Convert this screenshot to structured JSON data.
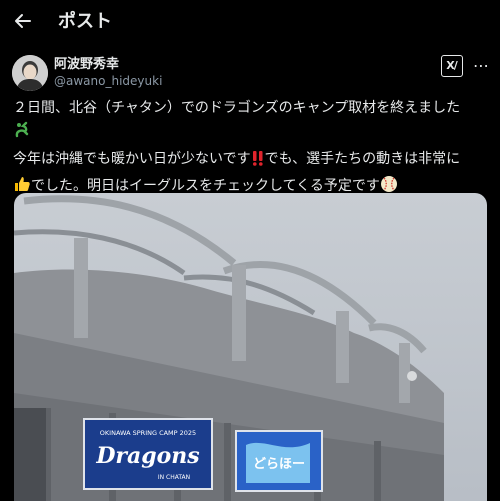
{
  "header": {
    "title": "ポスト",
    "back_icon": "arrow-left-icon"
  },
  "author": {
    "display_name": "阿波野秀幸",
    "handle": "@awano_hideyuki"
  },
  "actions": {
    "grok_icon": "grok-icon",
    "more_icon": "more-icon"
  },
  "tweet": {
    "line1": "２日間、北谷（チャタン）でのドラゴンズのキャンプ取材を終えました",
    "line2a": "今年は沖縄でも暖かい日が少ないです",
    "line2b": "でも、選手たちの動きは非常に",
    "line3a": "でした。明日はイーグルスをチェックしてくる予定です"
  },
  "image": {
    "banner_top": "OKINAWA SPRING CAMP 2025",
    "banner_logo": "Dragons",
    "banner_bottom": "IN CHATAN",
    "right_banner_text": "どらほー"
  },
  "colors": {
    "background": "#000000",
    "text": "#e7e9ea",
    "secondary": "#8b98a5",
    "banner_blue": "#1b3d8c"
  }
}
